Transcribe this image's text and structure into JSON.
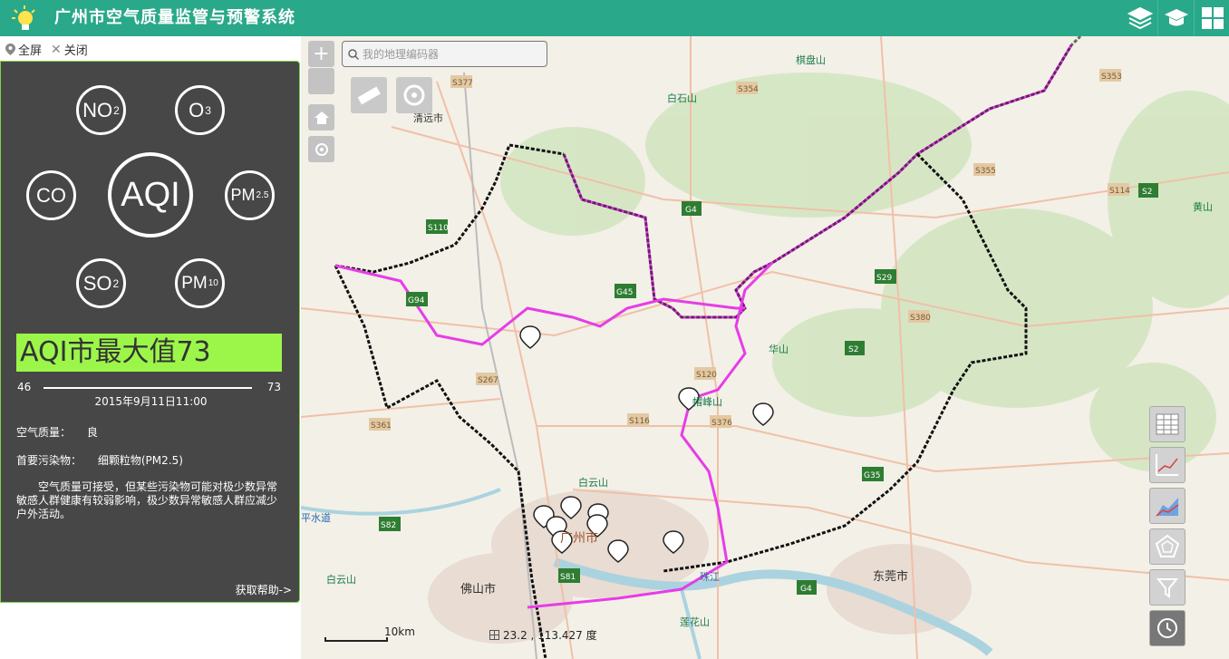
{
  "header": {
    "title": "广州市空气质量监管与预警系统"
  },
  "subbar": {
    "fullscreen": "全屏",
    "close": "关闭"
  },
  "pollutants": {
    "no2": "NO",
    "no2_sub": "2",
    "o3": "O",
    "o3_sub": "3",
    "co": "CO",
    "aqi": "AQI",
    "pm25": "PM",
    "pm25_sub": "2.5",
    "so2": "SO",
    "so2_sub": "2",
    "pm10": "PM",
    "pm10_sub": "10"
  },
  "summary": {
    "aqi_max_label": "AQI市最大值73",
    "range_min": "46",
    "range_max": "73",
    "datetime": "2015年9月11日11:00",
    "quality_label": "空气质量：",
    "quality_value": "良",
    "primary_label": "首要污染物：",
    "primary_value": "细颗粒物(PM2.5)",
    "advice": "空气质量可接受，但某些污染物可能对极少数异常敏感人群健康有较弱影响，极少数异常敏感人群应减少户外活动。",
    "help": "获取帮助->"
  },
  "map": {
    "search_placeholder": "我的地理编码器",
    "scale": "10km",
    "coords": "23.2 , 113.427 度",
    "labels": [
      "清远市",
      "白石山",
      "棋盘山",
      "黄山",
      "华山",
      "帽峰山",
      "白云山",
      "广州市",
      "佛山市",
      "东莞市",
      "平水道",
      "白云山",
      "莲花山",
      "珠江"
    ],
    "roads": [
      "S377",
      "S354",
      "S353",
      "S355",
      "S114",
      "S2",
      "G4",
      "S110",
      "S29",
      "G94",
      "G45",
      "S380",
      "S2",
      "S267",
      "S120",
      "S116",
      "S376",
      "S361",
      "G35",
      "S82",
      "S81",
      "G4"
    ]
  },
  "colors": {
    "header": "#2aa88a",
    "panel": "#474747",
    "accent": "#9cf64a",
    "boundary": "#e63de6"
  }
}
